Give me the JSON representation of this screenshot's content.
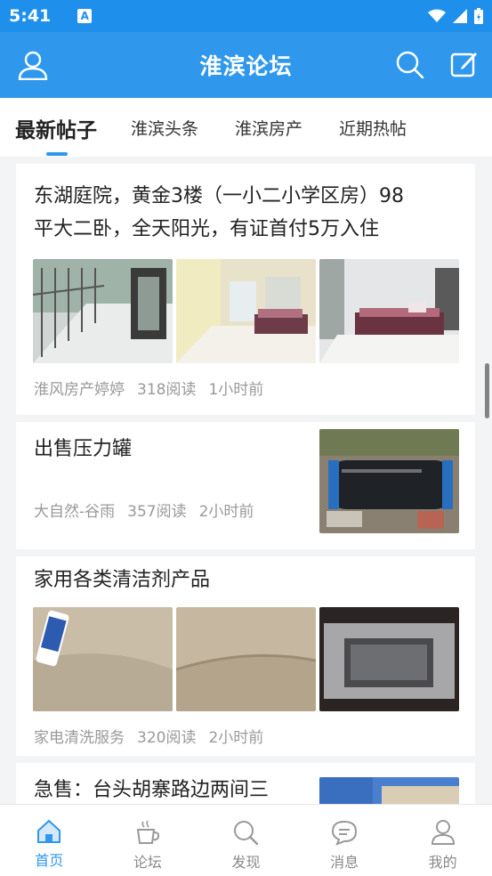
{
  "status_bar": {
    "time": "5:41",
    "notification_icon": "A"
  },
  "app_bar": {
    "title": "淮滨论坛"
  },
  "tabs": [
    {
      "label": "最新帖子",
      "active": true
    },
    {
      "label": "淮滨头条",
      "active": false
    },
    {
      "label": "淮滨房产",
      "active": false
    },
    {
      "label": "近期热帖",
      "active": false
    }
  ],
  "posts": [
    {
      "title_line1": "东湖庭院，黄金3楼（一小二小学区房）98",
      "title_line2": "平大二卧，全天阳光，有证首付5万入住",
      "author": "淮风房产婷婷",
      "reads": "318阅读",
      "time": "1小时前",
      "images": [
        "balcony-photo",
        "living-room-photo",
        "sofa-room-photo"
      ]
    },
    {
      "title": "出售压力罐",
      "author": "大自然-谷雨",
      "reads": "357阅读",
      "time": "2小时前",
      "images": [
        "pressure-tank-photo"
      ]
    },
    {
      "title": "家用各类清洁剂产品",
      "author": "家电清洗服务",
      "reads": "320阅读",
      "time": "2小时前",
      "images": [
        "cleaner-spray-photo",
        "leather-sofa-photo",
        "range-hood-photo"
      ]
    },
    {
      "title": "急售：台头胡寨路边两间三",
      "images": [
        "building-photo"
      ]
    }
  ],
  "bottom_nav": [
    {
      "label": "首页",
      "icon": "home-icon",
      "active": true
    },
    {
      "label": "论坛",
      "icon": "coffee-cup-icon",
      "active": false
    },
    {
      "label": "发现",
      "icon": "search-icon",
      "active": false
    },
    {
      "label": "消息",
      "icon": "chat-bubble-icon",
      "active": false
    },
    {
      "label": "我的",
      "icon": "user-icon",
      "active": false
    }
  ],
  "colors": {
    "primary": "#2f98ec",
    "statusbar": "#1e90ec",
    "muted_text": "#999999"
  }
}
